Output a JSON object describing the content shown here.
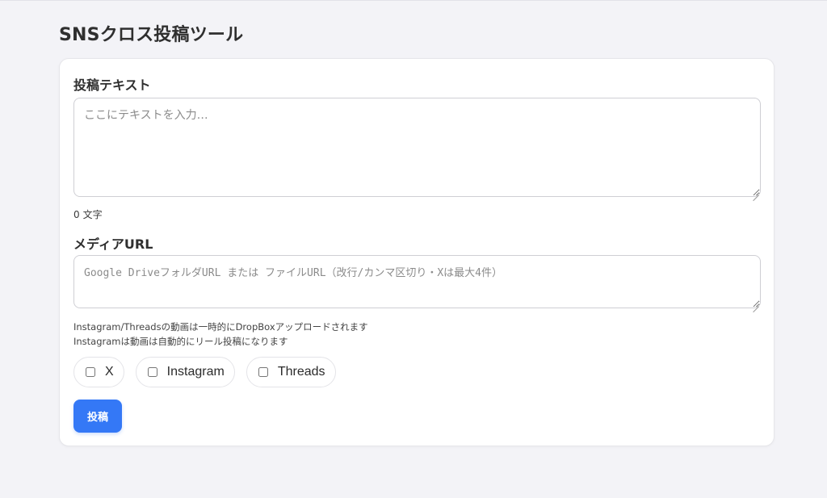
{
  "page": {
    "title": "SNSクロス投稿ツール"
  },
  "text_section": {
    "label": "投稿テキスト",
    "value": "",
    "placeholder": "ここにテキストを入力…",
    "char_count": "0",
    "char_unit": "文字"
  },
  "media_section": {
    "label": "メディアURL",
    "value": "",
    "placeholder": "Google DriveフォルダURL または ファイルURL（改行/カンマ区切り・Xは最大4件）",
    "notes": [
      "Instagram/Threadsの動画は一時的にDropBoxアップロードされます",
      "Instagramは動画は自動的にリール投稿になります"
    ]
  },
  "platforms": [
    {
      "label": "X",
      "checked": false
    },
    {
      "label": "Instagram",
      "checked": false
    },
    {
      "label": "Threads",
      "checked": false
    }
  ],
  "actions": {
    "post_label": "投稿"
  },
  "colors": {
    "accent": "#3478f6",
    "background": "#f3f3f7",
    "card": "#ffffff"
  }
}
